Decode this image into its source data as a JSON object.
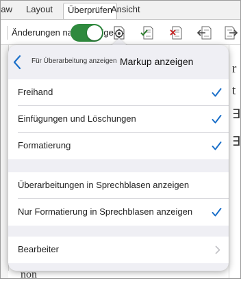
{
  "ribbon": {
    "tabs": [
      {
        "label": "Draw"
      },
      {
        "label": "Layout"
      },
      {
        "label": "Überprüfen"
      },
      {
        "label": "Ansicht"
      }
    ],
    "track_changes_label": "Änderungen nachverfolgen",
    "track_changes_on": true,
    "accent_color": "#2f8a3e"
  },
  "document": {
    "right_glyphs": [
      "r",
      "t",
      "∃",
      "∃"
    ],
    "bottom_text": "non"
  },
  "popover": {
    "back_label": "Für Überarbeitung anzeigen",
    "title": "Markup anzeigen",
    "check_color": "#1a6fc9",
    "group1": [
      {
        "label": "Freihand",
        "checked": true
      },
      {
        "label": "Einfügungen und Löschungen",
        "checked": true
      },
      {
        "label": "Formatierung",
        "checked": true
      }
    ],
    "group2": [
      {
        "label": "Überarbeitungen in Sprechblasen anzeigen",
        "checked": false
      },
      {
        "label": "Nur Formatierung in Sprechblasen anzeigen",
        "checked": true
      }
    ],
    "group3": [
      {
        "label": "Bearbeiter"
      }
    ]
  }
}
